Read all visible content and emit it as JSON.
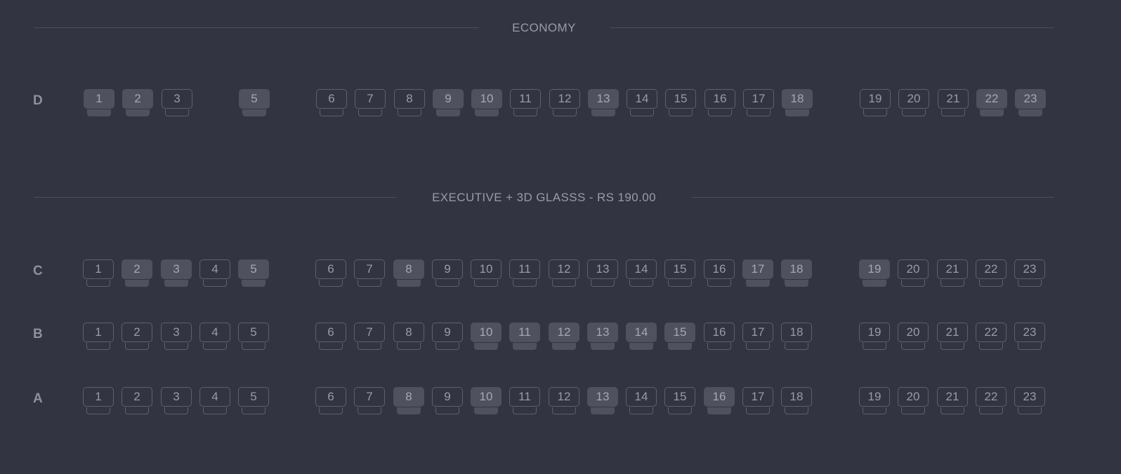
{
  "sections": [
    {
      "title": "ECONOMY",
      "rows": [
        {
          "label": "D",
          "seats": [
            {
              "number": "1",
              "taken": true
            },
            {
              "number": "2",
              "taken": true
            },
            {
              "number": "3",
              "taken": false
            },
            {
              "number": "5",
              "taken": true
            },
            {
              "number": "6",
              "taken": false
            },
            {
              "number": "7",
              "taken": false
            },
            {
              "number": "8",
              "taken": false
            },
            {
              "number": "9",
              "taken": true
            },
            {
              "number": "10",
              "taken": true
            },
            {
              "number": "11",
              "taken": false
            },
            {
              "number": "12",
              "taken": false
            },
            {
              "number": "13",
              "taken": true
            },
            {
              "number": "14",
              "taken": false
            },
            {
              "number": "15",
              "taken": false
            },
            {
              "number": "16",
              "taken": false
            },
            {
              "number": "17",
              "taken": false
            },
            {
              "number": "18",
              "taken": true
            },
            {
              "number": "19",
              "taken": false
            },
            {
              "number": "20",
              "taken": false
            },
            {
              "number": "21",
              "taken": false
            },
            {
              "number": "22",
              "taken": true
            },
            {
              "number": "23",
              "taken": true
            }
          ]
        }
      ]
    },
    {
      "title": "EXECUTIVE + 3D GLASSS - RS 190.00",
      "rows": [
        {
          "label": "C",
          "seats": [
            {
              "number": "1",
              "taken": false
            },
            {
              "number": "2",
              "taken": true
            },
            {
              "number": "3",
              "taken": true
            },
            {
              "number": "4",
              "taken": false
            },
            {
              "number": "5",
              "taken": true
            },
            {
              "number": "6",
              "taken": false
            },
            {
              "number": "7",
              "taken": false
            },
            {
              "number": "8",
              "taken": true
            },
            {
              "number": "9",
              "taken": false
            },
            {
              "number": "10",
              "taken": false
            },
            {
              "number": "11",
              "taken": false
            },
            {
              "number": "12",
              "taken": false
            },
            {
              "number": "13",
              "taken": false
            },
            {
              "number": "14",
              "taken": false
            },
            {
              "number": "15",
              "taken": false
            },
            {
              "number": "16",
              "taken": false
            },
            {
              "number": "17",
              "taken": true
            },
            {
              "number": "18",
              "taken": true
            },
            {
              "number": "19",
              "taken": true
            },
            {
              "number": "20",
              "taken": false
            },
            {
              "number": "21",
              "taken": false
            },
            {
              "number": "22",
              "taken": false
            },
            {
              "number": "23",
              "taken": false
            }
          ]
        },
        {
          "label": "B",
          "seats": [
            {
              "number": "1",
              "taken": false
            },
            {
              "number": "2",
              "taken": false
            },
            {
              "number": "3",
              "taken": false
            },
            {
              "number": "4",
              "taken": false
            },
            {
              "number": "5",
              "taken": false
            },
            {
              "number": "6",
              "taken": false
            },
            {
              "number": "7",
              "taken": false
            },
            {
              "number": "8",
              "taken": false
            },
            {
              "number": "9",
              "taken": false
            },
            {
              "number": "10",
              "taken": true
            },
            {
              "number": "11",
              "taken": true
            },
            {
              "number": "12",
              "taken": true
            },
            {
              "number": "13",
              "taken": true
            },
            {
              "number": "14",
              "taken": true
            },
            {
              "number": "15",
              "taken": true
            },
            {
              "number": "16",
              "taken": false
            },
            {
              "number": "17",
              "taken": false
            },
            {
              "number": "18",
              "taken": false
            },
            {
              "number": "19",
              "taken": false
            },
            {
              "number": "20",
              "taken": false
            },
            {
              "number": "21",
              "taken": false
            },
            {
              "number": "22",
              "taken": false
            },
            {
              "number": "23",
              "taken": false
            }
          ]
        },
        {
          "label": "A",
          "seats": [
            {
              "number": "1",
              "taken": false
            },
            {
              "number": "2",
              "taken": false
            },
            {
              "number": "3",
              "taken": false
            },
            {
              "number": "4",
              "taken": false
            },
            {
              "number": "5",
              "taken": false
            },
            {
              "number": "6",
              "taken": false
            },
            {
              "number": "7",
              "taken": false
            },
            {
              "number": "8",
              "taken": true
            },
            {
              "number": "9",
              "taken": false
            },
            {
              "number": "10",
              "taken": true
            },
            {
              "number": "11",
              "taken": false
            },
            {
              "number": "12",
              "taken": false
            },
            {
              "number": "13",
              "taken": true
            },
            {
              "number": "14",
              "taken": false
            },
            {
              "number": "15",
              "taken": false
            },
            {
              "number": "16",
              "taken": true
            },
            {
              "number": "17",
              "taken": false
            },
            {
              "number": "18",
              "taken": false
            },
            {
              "number": "19",
              "taken": false
            },
            {
              "number": "20",
              "taken": false
            },
            {
              "number": "21",
              "taken": false
            },
            {
              "number": "22",
              "taken": false
            },
            {
              "number": "23",
              "taken": false
            }
          ]
        }
      ]
    }
  ],
  "colors": {
    "background": "#323442",
    "seat_border": "#5e606c",
    "seat_taken": "#4f515e",
    "text": "#9a9ba6"
  }
}
